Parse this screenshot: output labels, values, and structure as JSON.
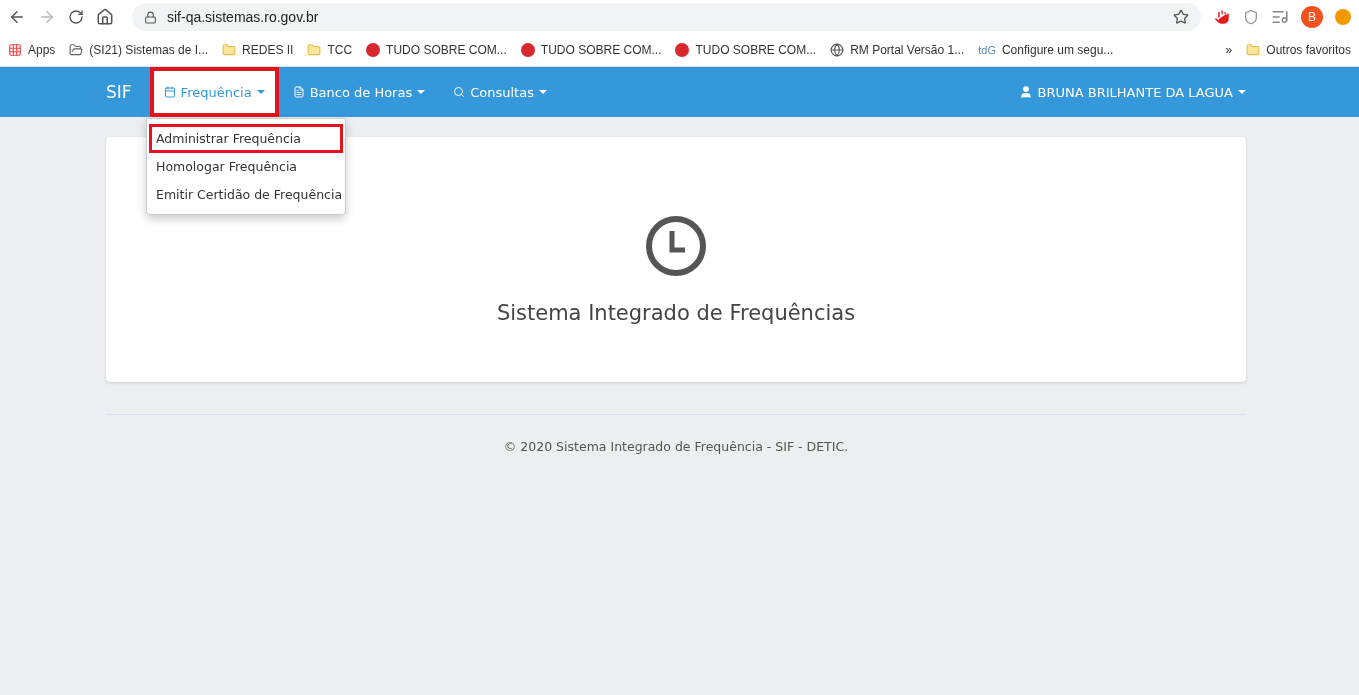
{
  "browser": {
    "url": "sif-qa.sistemas.ro.gov.br",
    "profile_initial": "B",
    "bookmarks": [
      {
        "kind": "apps",
        "label": "Apps"
      },
      {
        "kind": "site",
        "label": "(SI21) Sistemas de I..."
      },
      {
        "kind": "folder",
        "label": "REDES II"
      },
      {
        "kind": "folder",
        "label": "TCC"
      },
      {
        "kind": "mega",
        "label": "TUDO SOBRE COM..."
      },
      {
        "kind": "mega",
        "label": "TUDO SOBRE COM..."
      },
      {
        "kind": "mega",
        "label": "TUDO SOBRE COM..."
      },
      {
        "kind": "globe",
        "label": "RM Portal Versão 1..."
      },
      {
        "kind": "text",
        "badge": "tdG",
        "label": "Configure um segu..."
      }
    ],
    "more": "»",
    "other_bookmarks": "Outros favoritos"
  },
  "navbar": {
    "brand": "SIF",
    "menus": [
      {
        "kind": "calendar",
        "label": "Frequência",
        "expanded": true,
        "highlighted": true
      },
      {
        "kind": "file",
        "label": "Banco de Horas",
        "expanded": false,
        "highlighted": false
      },
      {
        "kind": "search",
        "label": "Consultas",
        "expanded": false,
        "highlighted": false
      }
    ],
    "user": "BRUNA BRILHANTE DA LAGUA"
  },
  "dropdown": [
    {
      "label": "Administrar Frequência",
      "highlighted": true
    },
    {
      "label": "Homologar Frequência",
      "highlighted": false
    },
    {
      "label": "Emitir Certidão de Frequência",
      "highlighted": false
    }
  ],
  "card": {
    "title": "Sistema Integrado de Frequências"
  },
  "footer": "© 2020 Sistema Integrado de Frequência - SIF - DETIC."
}
